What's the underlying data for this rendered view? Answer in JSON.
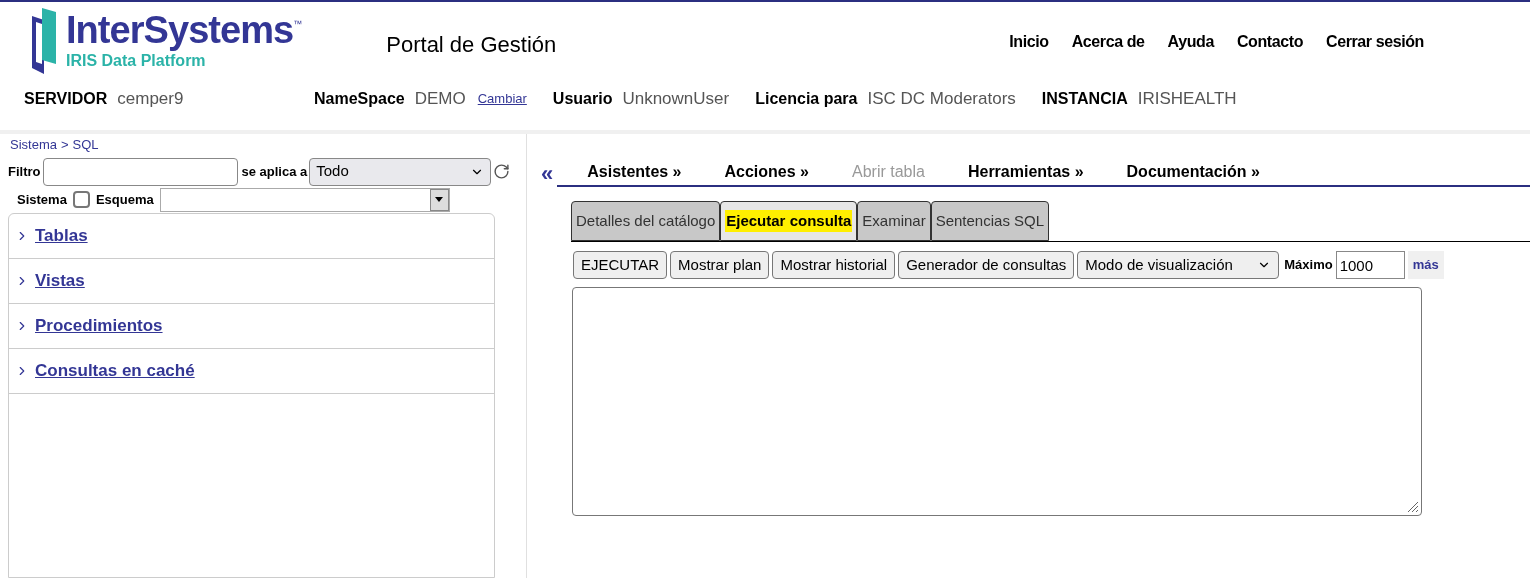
{
  "header": {
    "brand": "InterSystems",
    "trademark": "™",
    "product": "IRIS Data Platform",
    "portal_title": "Portal de Gestión",
    "nav": [
      "Inicio",
      "Acerca de",
      "Ayuda",
      "Contacto",
      "Cerrar sesión"
    ],
    "info": [
      {
        "label": "SERVIDOR",
        "value": "cemper9"
      },
      {
        "label": "NameSpace",
        "value": "DEMO",
        "link": "Cambiar"
      },
      {
        "label": "Usuario",
        "value": "UnknownUser"
      },
      {
        "label": "Licencia para",
        "value": "ISC DC Moderators"
      },
      {
        "label": "INSTANCIA",
        "value": "IRISHEALTH"
      }
    ]
  },
  "breadcrumb": [
    "Sistema",
    "SQL"
  ],
  "breadcrumb_separator": ">",
  "filter": {
    "label": "Filtro",
    "applies_label": "se aplica a",
    "applies_value": "Todo",
    "system_label": "Sistema",
    "system_checked": false,
    "schema_label": "Esquema"
  },
  "tree": [
    {
      "label": "Tablas",
      "expanded": false
    },
    {
      "label": "Vistas",
      "expanded": false
    },
    {
      "label": "Procedimientos",
      "expanded": false
    },
    {
      "label": "Consultas en caché",
      "expanded": false
    }
  ],
  "collapse_glyph": "«",
  "menu": [
    {
      "label": "Asistentes »",
      "disabled": false
    },
    {
      "label": "Acciones »",
      "disabled": false
    },
    {
      "label": "Abrir tabla",
      "disabled": true
    },
    {
      "label": "Herramientas »",
      "disabled": false
    },
    {
      "label": "Documentación »",
      "disabled": false
    }
  ],
  "tabs": [
    {
      "label": "Detalles del catálogo",
      "selected": false
    },
    {
      "label": "Ejecutar consulta",
      "selected": true
    },
    {
      "label": "Examinar",
      "selected": false
    },
    {
      "label": "Sentencias SQL",
      "selected": false
    }
  ],
  "toolbar": {
    "buttons": [
      "EJECUTAR",
      "Mostrar plan",
      "Mostrar historial",
      "Generador de consultas"
    ],
    "mode_select": "Modo de visualización",
    "max_label": "Máximo",
    "max_value": "1000",
    "more_link": "más"
  }
}
